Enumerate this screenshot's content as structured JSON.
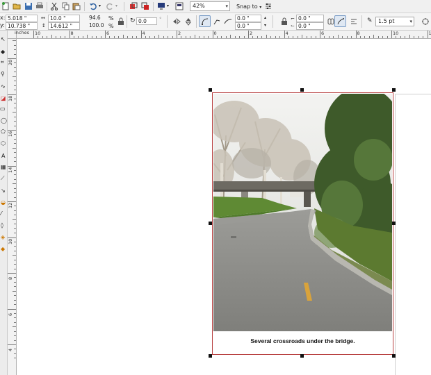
{
  "toolbar": {
    "zoom": "42%",
    "snap_to": "Snap to",
    "outline_width": "1.5 pt"
  },
  "property_bar": {
    "pos_x": "5.018 \"",
    "pos_y": "10.738 \"",
    "x_label": "x:",
    "y_label": "y:",
    "width": "10.0 \"",
    "height": "14.612 \"",
    "scale_x": "94.6",
    "scale_y": "100.0",
    "percent": "%",
    "rotation": "0.0",
    "skew_h1": "0.0 \"",
    "skew_v1": "0.0 \"",
    "skew_h2": "0.0 \"",
    "skew_v2": "0.0 \""
  },
  "ruler": {
    "h_labels": [
      "10",
      "8",
      "6",
      "4",
      "2",
      "0",
      "2",
      "4",
      "6",
      "8",
      "10",
      "12"
    ],
    "h_unit": "inches",
    "v_labels": [
      "20",
      "18",
      "16",
      "14",
      "12",
      "10",
      "8",
      "6",
      "4"
    ]
  },
  "document": {
    "caption": "Several crossroads under the bridge."
  },
  "colors": {
    "selection": "#b84040",
    "toolbar_bg": "#f0f0f0"
  }
}
